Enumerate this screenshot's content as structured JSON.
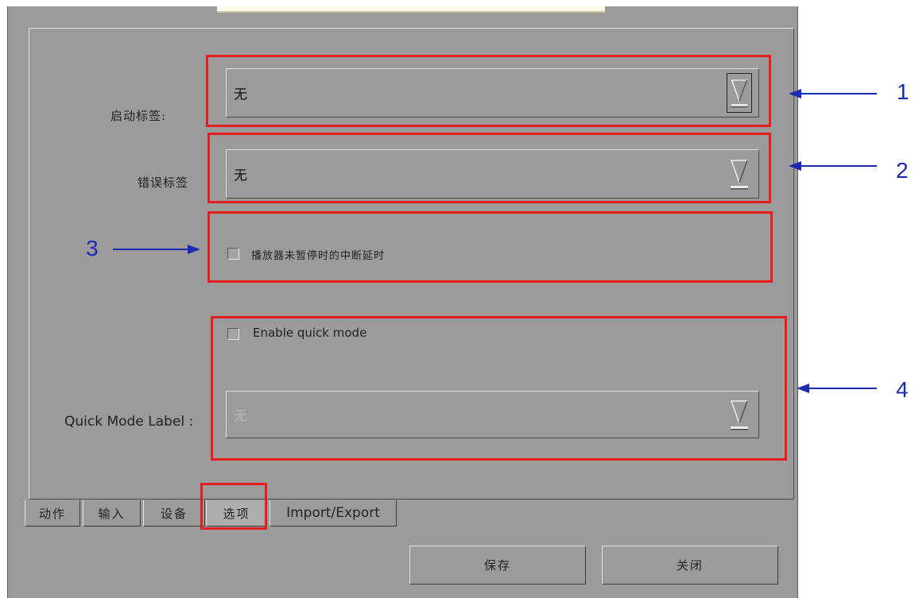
{
  "window": {
    "startup_label": {
      "label": "启动标签:",
      "value": "无"
    },
    "error_label": {
      "label": "错误标签",
      "value": "无"
    },
    "interrupt_delay_checkbox": {
      "label": "播放器未暂停时的中断延时",
      "checked": false
    },
    "quick_mode_checkbox": {
      "label": "Enable quick mode",
      "checked": false
    },
    "quick_mode_label": {
      "label": "Quick Mode Label :",
      "value": "无",
      "disabled": true
    },
    "tabs": [
      {
        "label": "动作",
        "active": false
      },
      {
        "label": "输入",
        "active": false
      },
      {
        "label": "设备",
        "active": false
      },
      {
        "label": "选项",
        "active": true
      },
      {
        "label": "Import/Export",
        "active": false
      }
    ],
    "buttons": {
      "save": "保存",
      "close": "关闭"
    }
  },
  "annotations": {
    "callouts": [
      "1",
      "2",
      "3",
      "4"
    ],
    "highlight_color": "#e51d1d",
    "arrow_color": "#1a2bb0"
  },
  "colors": {
    "window_bg": "#9b9b9b",
    "page_bg": "#ffffff"
  }
}
